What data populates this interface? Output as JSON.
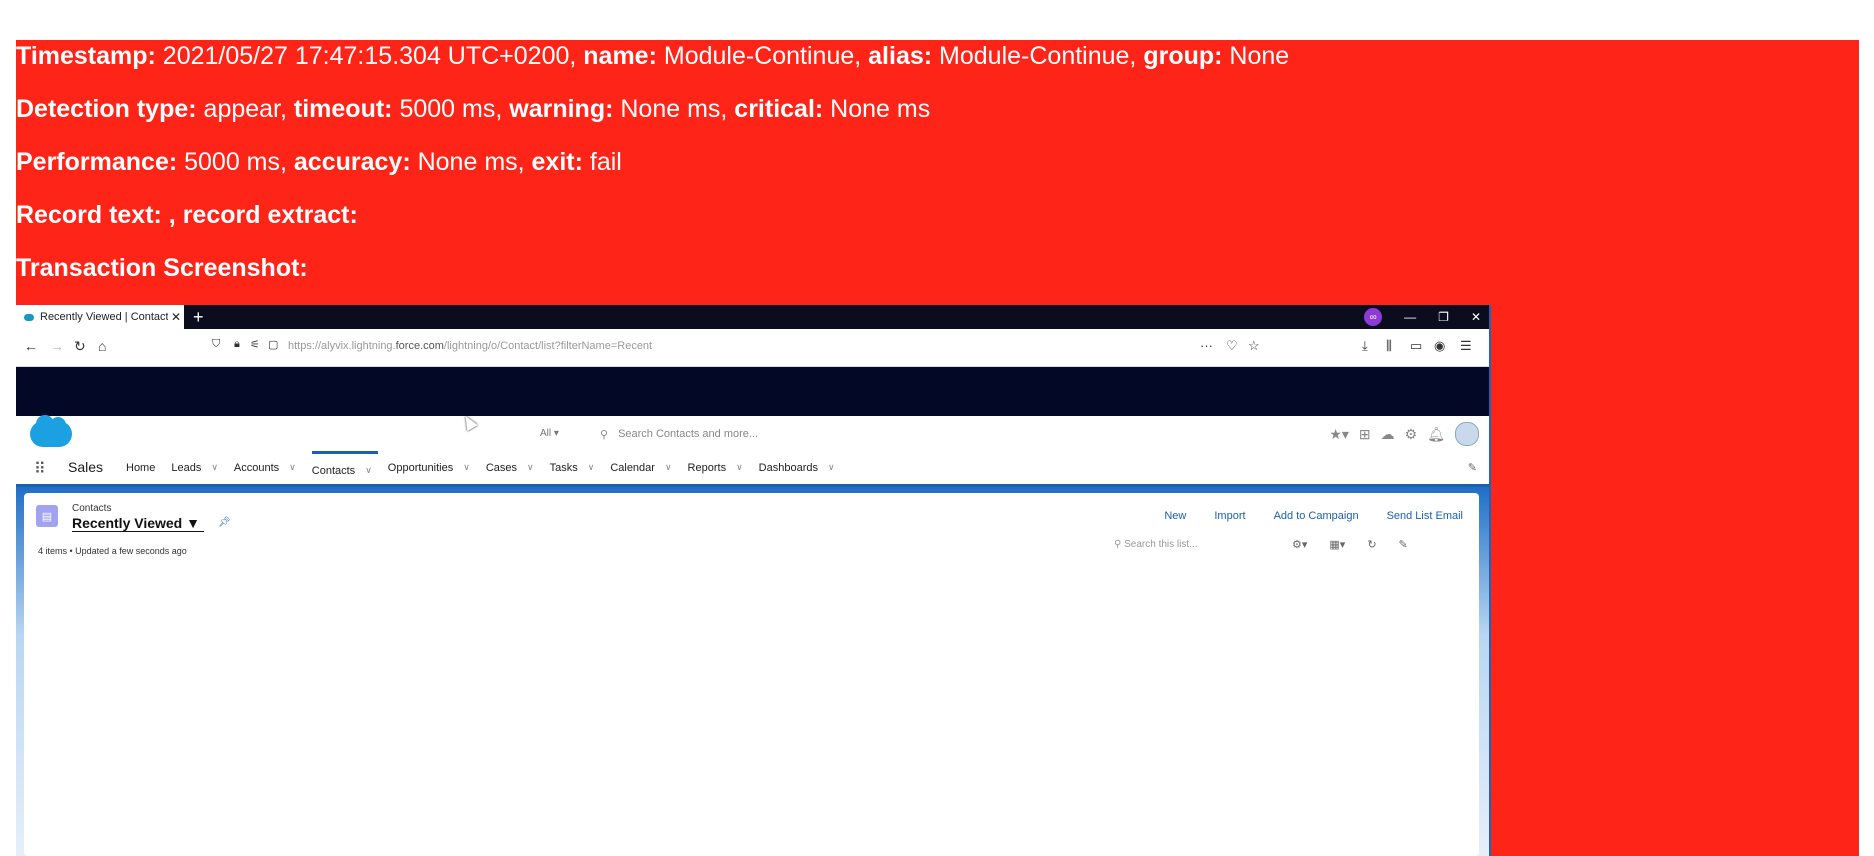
{
  "report": {
    "line1": [
      {
        "label": "Timestamp:",
        "value": " 2021/05/27 17:47:15.304 UTC+0200, "
      },
      {
        "label": "name:",
        "value": " Module-Continue, "
      },
      {
        "label": "alias:",
        "value": " Module-Continue, "
      },
      {
        "label": "group:",
        "value": " None"
      }
    ],
    "line2": [
      {
        "label": "Detection type:",
        "value": " appear, "
      },
      {
        "label": "timeout:",
        "value": " 5000 ms, "
      },
      {
        "label": "warning:",
        "value": " None ms, "
      },
      {
        "label": "critical:",
        "value": " None ms"
      }
    ],
    "line3": [
      {
        "label": "Performance:",
        "value": " 5000 ms, "
      },
      {
        "label": "accuracy:",
        "value": " None ms, "
      },
      {
        "label": "exit:",
        "value": " fail"
      }
    ],
    "line4": {
      "label": "Record text: , record extract:"
    },
    "line5": {
      "label": "Transaction Screenshot:"
    }
  },
  "browser": {
    "tab_title": "Recently Viewed | Contacts | S",
    "url_prefix": "https://alyvix.lightning.",
    "url_host": "force.com",
    "url_path": "/lightning/o/Contact/list?filterName=Recent"
  },
  "salesforce": {
    "search_scope": "All",
    "search_placeholder": "Search Contacts and more...",
    "app_name": "Sales",
    "nav": [
      "Home",
      "Leads",
      "Accounts",
      "Contacts",
      "Opportunities",
      "Cases",
      "Tasks",
      "Calendar",
      "Reports",
      "Dashboards"
    ],
    "object_label": "Contacts",
    "list_view_name": "Recently Viewed",
    "list_meta": "4 items • Updated a few seconds ago",
    "actions": [
      "New",
      "Import",
      "Add to Campaign",
      "Send List Email"
    ],
    "list_search_placeholder": "Search this list..."
  }
}
